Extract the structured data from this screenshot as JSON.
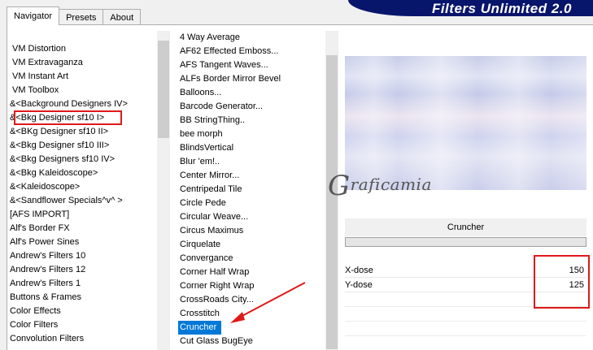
{
  "tabs": [
    {
      "label": "Navigator",
      "active": true
    },
    {
      "label": "Presets",
      "active": false
    },
    {
      "label": "About",
      "active": false
    }
  ],
  "banner": {
    "title": "Filters Unlimited 2.0"
  },
  "categories": [
    "VM Distortion",
    "VM Extravaganza",
    "VM Instant Art",
    "VM Toolbox",
    "&<Background Designers IV>",
    "&<Bkg Designer sf10 I>",
    "&<BKg Designer sf10 II>",
    "&<Bkg Designer sf10 III>",
    "&<Bkg Designers sf10 IV>",
    "&<Bkg Kaleidoscope>",
    "&<Kaleidoscope>",
    "&<Sandflower Specials^v^ >",
    "[AFS IMPORT]",
    "Alf's Border FX",
    "Alf's Power Sines",
    "Andrew's Filters 10",
    "Andrew's Filters 12",
    "Andrew's Filters 1",
    "Buttons & Frames",
    "Color Effects",
    "Color Filters",
    "Convolution Filters"
  ],
  "filters": [
    "4 Way Average",
    "AF62 Effected Emboss...",
    "AFS Tangent Waves...",
    "ALFs Border Mirror Bevel",
    "Balloons...",
    "Barcode Generator...",
    "BB StringThing..",
    "bee morph",
    "BlindsVertical",
    "Blur 'em!..",
    "Center Mirror...",
    "Centripedal Tile",
    "Circle Pede",
    "Circular Weave...",
    "Circus Maximus",
    "Cirquelate",
    "Convergance",
    "Corner Half Wrap",
    "Corner Right Wrap",
    "CrossRoads City...",
    "Crosstitch",
    "Cruncher",
    "Cut Glass  BugEye"
  ],
  "selected_filter": "Cruncher",
  "highlighted_category": "&<Bkg Designer sf10 I>",
  "watermark": {
    "initial": "G",
    "rest": "raficamia"
  },
  "filter_panel": {
    "name": "Cruncher",
    "params": [
      {
        "name": "X-dose",
        "value": "150"
      },
      {
        "name": "Y-dose",
        "value": "125"
      }
    ]
  },
  "colors": {
    "selection": "#0078d7",
    "annotation": "#e01818",
    "banner": "#07156b"
  }
}
